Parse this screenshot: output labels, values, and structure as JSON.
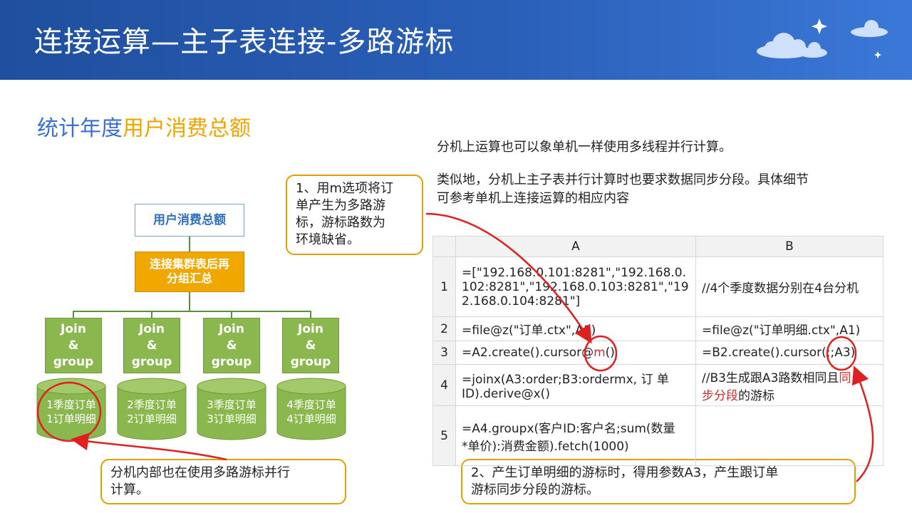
{
  "header": {
    "title": "连接运算—主子表连接-多路游标"
  },
  "subtitle": {
    "part1": "统计年度",
    "part2": "用户消费总额"
  },
  "intro": {
    "p1": "分机上运算也可以象单机一样使用多线程并行计算。",
    "p2_line1": "类似地，分机上主子表并行计算时也要求数据同步分段。具体细节",
    "p2_line2": "可参考单机上连接运算的相应内容"
  },
  "diagram": {
    "root": "用户消费总额",
    "merge_line1": "连接集群表后再",
    "merge_line2": "分组汇总",
    "join": {
      "l1": "Join",
      "l2": "&",
      "l3": "group"
    },
    "nodes": [
      {
        "l1": "1季度订单",
        "l2": "1订单明细"
      },
      {
        "l1": "2季度订单",
        "l2": "2订单明细"
      },
      {
        "l1": "3季度订单",
        "l2": "3订单明细"
      },
      {
        "l1": "4季度订单",
        "l2": "4订单明细"
      }
    ]
  },
  "callouts": {
    "c1": [
      "1、用m选项将订",
      "单产生为多路游",
      "标，游标路数为",
      "环境缺省。"
    ],
    "c2": [
      "分机内部也在使用多路游标并行",
      "计算。"
    ],
    "c3": [
      "2、产生订单明细的游标时，得用参数A3，产生跟订单",
      "游标同步分段的游标。"
    ]
  },
  "table": {
    "col_a": "A",
    "col_b": "B",
    "rows": [
      {
        "n": "1",
        "a_l1": "=[\"192.168.0.101:8281\",\"192.168.0.",
        "a_l2": "102:8281\",\"192.168.0.103:8281\",\"19",
        "a_l3": "2.168.0.104:8281\"]",
        "b": "//4个季度数据分别在4台分机"
      },
      {
        "n": "2",
        "a": "=file@z(\"订单.ctx\",A1)",
        "b": "=file@z(\"订单明细.ctx\",A1)"
      },
      {
        "n": "3",
        "a_pre": "=A2.create().cursor@",
        "a_red": "m",
        "a_post": "()",
        "b": "=B2.create().cursor(;;A3)"
      },
      {
        "n": "4",
        "a_l1": "=joinx(A3:order;B3:ordermx,  订  单",
        "a_l2": "ID).derive@x()",
        "b_pre": "//B3生成跟A3路数相同且",
        "b_red1": "同",
        "b_red2": "步分段",
        "b_post": "的游标"
      },
      {
        "n": "5",
        "a_l1": "=A4.groupx(客户ID:客户名;sum(数量",
        "a_l2": "*单价):消费金额).fetch(1000)",
        "b": ""
      }
    ]
  },
  "colors": {
    "accent_orange": "#f0a800",
    "green": "#8ab74e",
    "header_blue": "#2a5fb8",
    "highlight_red": "#d9272e"
  }
}
